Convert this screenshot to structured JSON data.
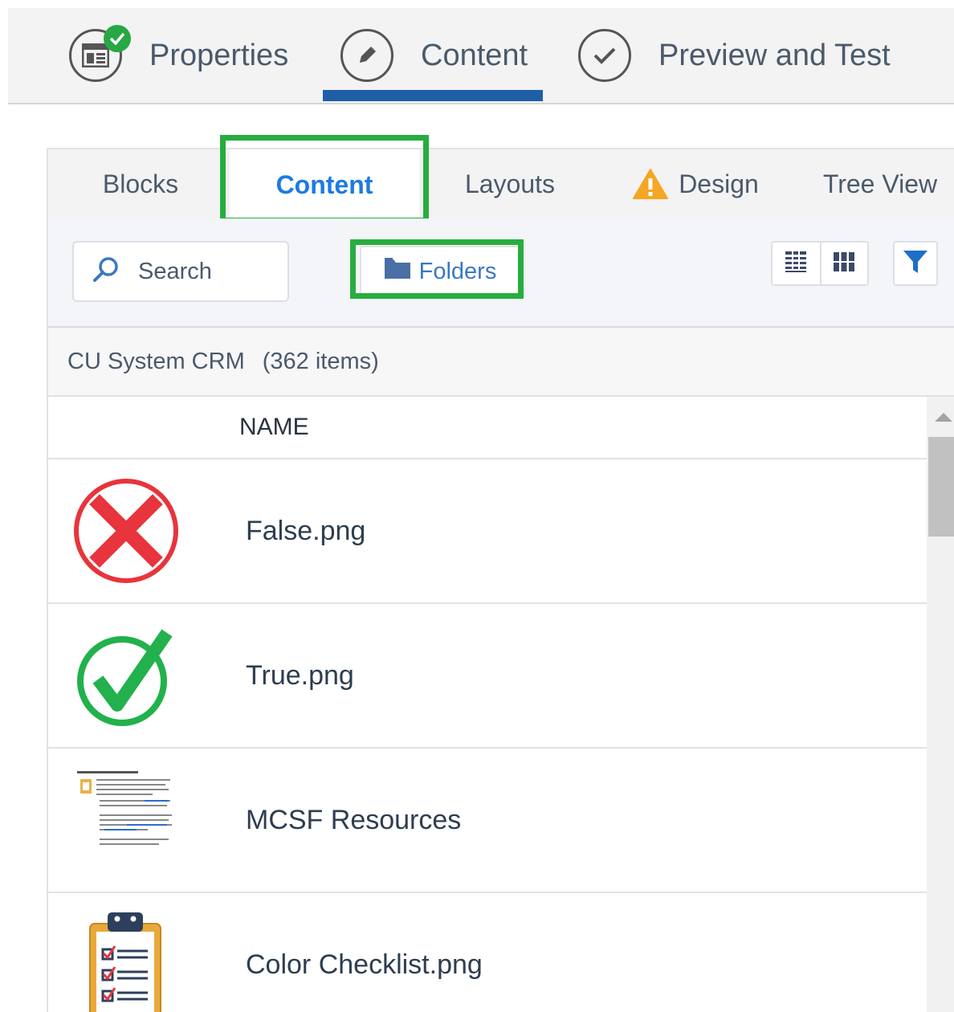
{
  "steps": [
    {
      "label": "Properties",
      "icon": "properties-icon",
      "completed": true
    },
    {
      "label": "Content",
      "icon": "pencil-icon",
      "active": true
    },
    {
      "label": "Preview and Test",
      "icon": "check-circle-icon"
    }
  ],
  "tabs": {
    "blocks": "Blocks",
    "content": "Content",
    "layouts": "Layouts",
    "design": "Design",
    "tree_view": "Tree View",
    "active": "content"
  },
  "toolbar": {
    "search_label": "Search",
    "folders_label": "Folders"
  },
  "folder_info": {
    "name": "CU System CRM",
    "count": "(362 items)"
  },
  "list": {
    "name_header": "NAME",
    "items": [
      {
        "name": "False.png",
        "thumb": "red-x-icon"
      },
      {
        "name": "True.png",
        "thumb": "green-check-icon"
      },
      {
        "name": "MCSF Resources",
        "thumb": "document-thumbnail"
      },
      {
        "name": "Color Checklist.png",
        "thumb": "clipboard-checklist-icon"
      }
    ]
  },
  "colors": {
    "accent_blue": "#1e7ae0",
    "step_underline": "#1f5fa8",
    "highlight_green": "#27ad3f",
    "warning": "#f5a623"
  }
}
